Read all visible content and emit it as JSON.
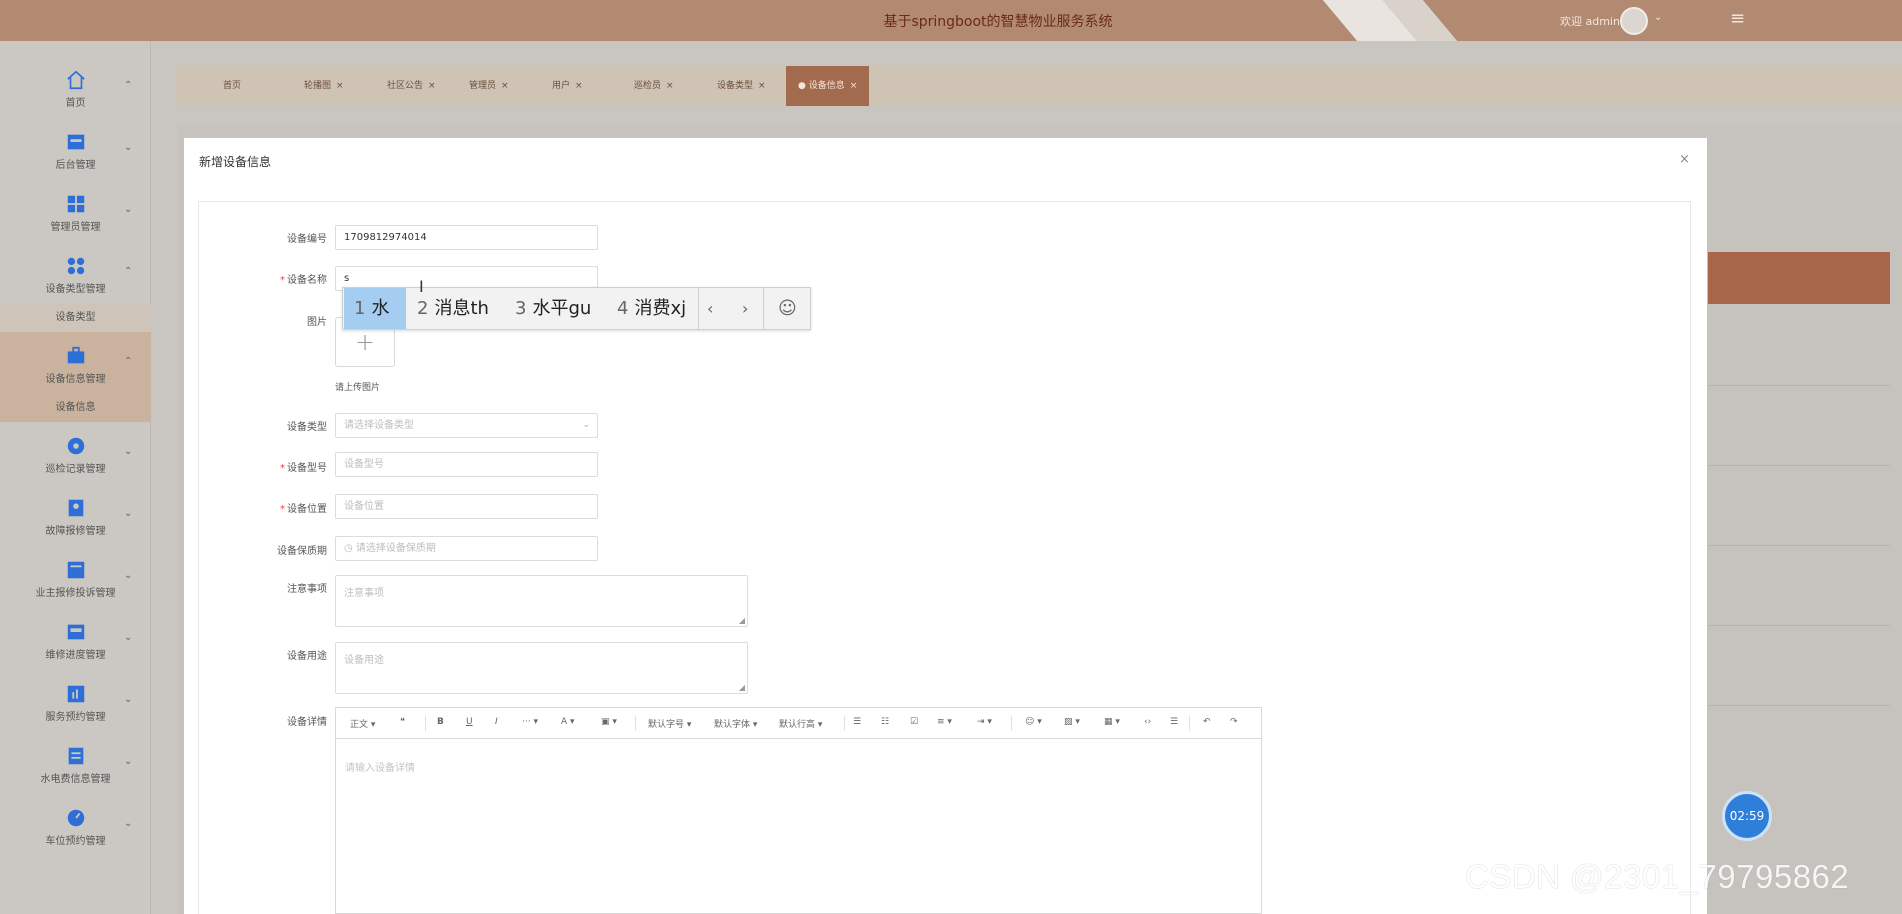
{
  "header": {
    "title": "基于springboot的智慧物业服务系统",
    "welcome": "欢迎 admin"
  },
  "sidebar": {
    "items": [
      {
        "label": "首页"
      },
      {
        "label": "后台管理"
      },
      {
        "label": "管理员管理"
      },
      {
        "label": "设备类型管理",
        "sub": "设备类型"
      },
      {
        "label": "设备信息管理",
        "sub": "设备信息"
      },
      {
        "label": "巡检记录管理"
      },
      {
        "label": "故障报修管理"
      },
      {
        "label": "业主报修投诉管理"
      },
      {
        "label": "维修进度管理"
      },
      {
        "label": "服务预约管理"
      },
      {
        "label": "水电费信息管理"
      },
      {
        "label": "车位预约管理"
      }
    ]
  },
  "tabs": [
    "首页",
    "轮播图",
    "社区公告",
    "管理员",
    "用户",
    "巡检员",
    "设备类型",
    "设备信息"
  ],
  "dialog": {
    "title": "新增设备信息",
    "fields": {
      "device_no": {
        "label": "设备编号",
        "value": "1709812974014"
      },
      "device_name": {
        "label": "设备名称",
        "value": "s"
      },
      "image": {
        "label": "图片",
        "hint": "请上传图片"
      },
      "device_type": {
        "label": "设备类型",
        "placeholder": "请选择设备类型"
      },
      "device_model": {
        "label": "设备型号",
        "placeholder": "设备型号"
      },
      "device_location": {
        "label": "设备位置",
        "placeholder": "设备位置"
      },
      "warranty": {
        "label": "设备保质期",
        "placeholder": "请选择设备保质期"
      },
      "notes": {
        "label": "注意事项",
        "placeholder": "注意事项"
      },
      "usage": {
        "label": "设备用途",
        "placeholder": "设备用途"
      },
      "detail": {
        "label": "设备详情",
        "placeholder": "请输入设备详情"
      }
    },
    "editor_toolbar": {
      "paragraph": "正文",
      "font_size": "默认字号",
      "font_family": "默认字体",
      "line_height": "默认行高"
    }
  },
  "ime": {
    "candidates": [
      {
        "num": "1",
        "text": "水"
      },
      {
        "num": "2",
        "text": "消息th"
      },
      {
        "num": "3",
        "text": "水平gu"
      },
      {
        "num": "4",
        "text": "消费xj"
      }
    ]
  },
  "timer": "02:59",
  "watermark": "CSDN @2301_79795862"
}
